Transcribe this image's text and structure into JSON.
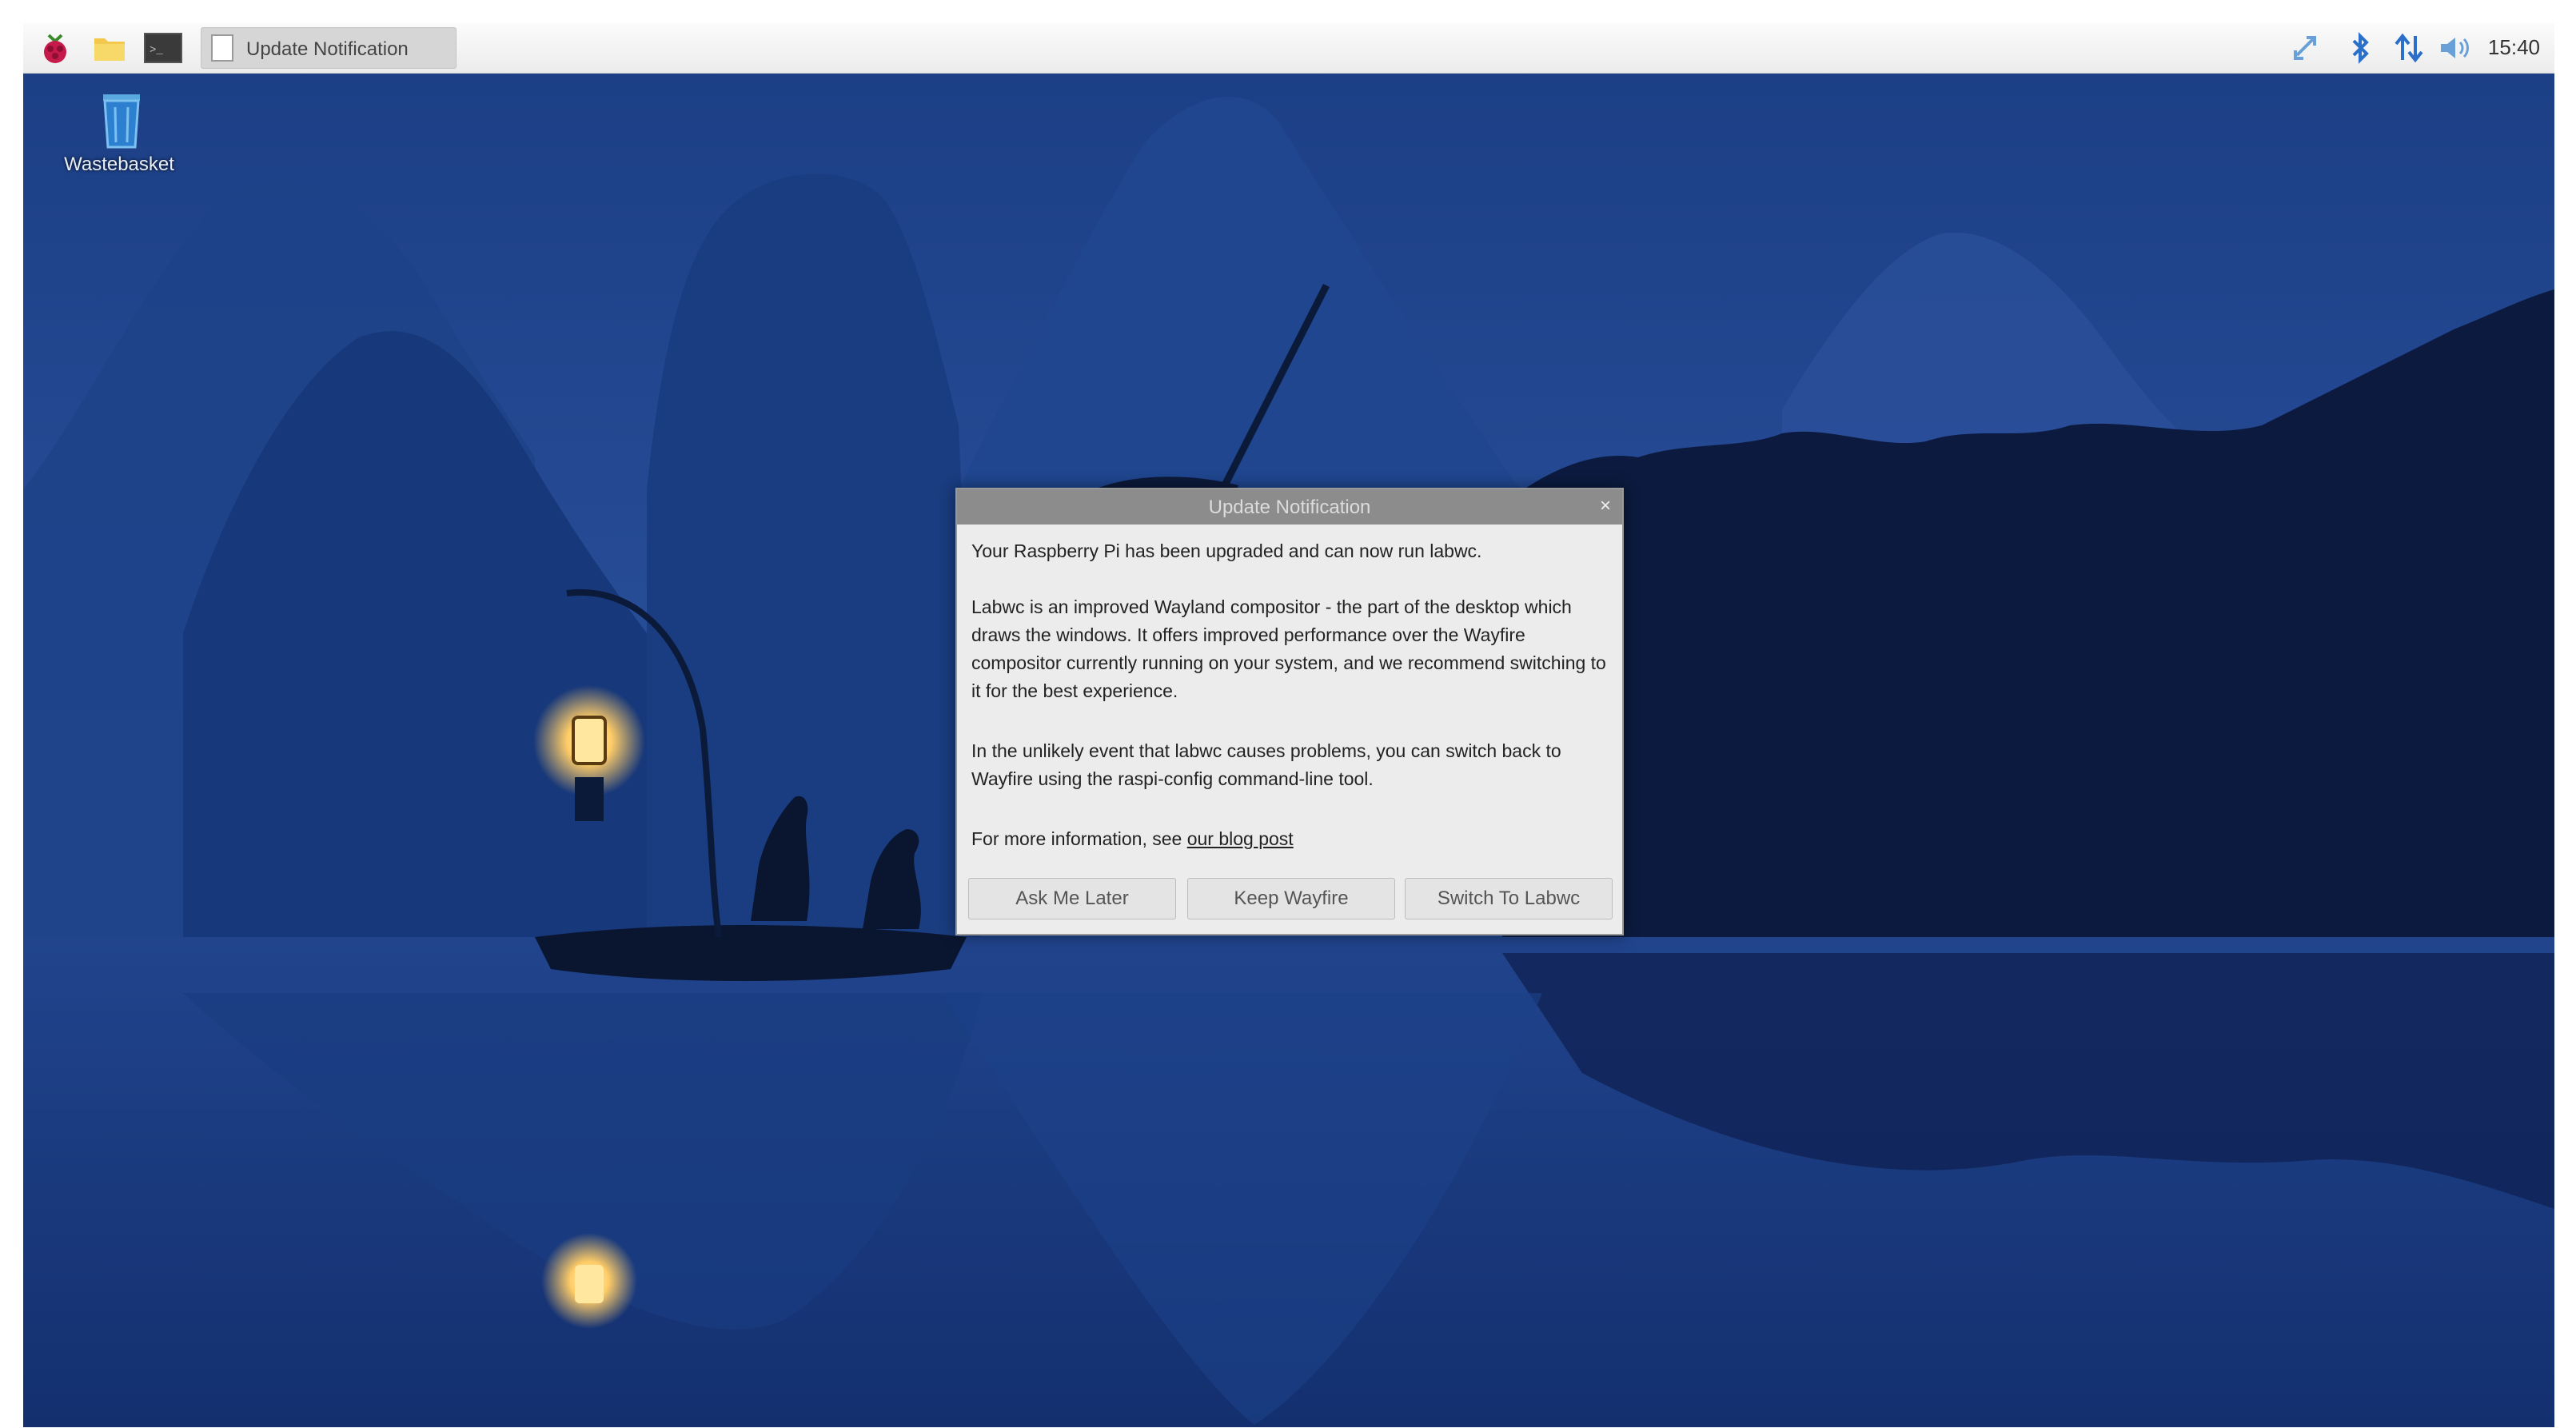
{
  "taskbar": {
    "launchers": [
      {
        "icon": "raspberry-menu-icon"
      },
      {
        "icon": "folder-icon"
      },
      {
        "icon": "terminal-icon"
      }
    ],
    "task_button": {
      "label": "Update Notification",
      "icon": "document-icon"
    },
    "tray": [
      {
        "icon": "sync-icon"
      },
      {
        "icon": "bluetooth-icon"
      },
      {
        "icon": "network-arrows-icon"
      },
      {
        "icon": "volume-icon"
      }
    ],
    "clock": "15:40"
  },
  "desktop": {
    "icons": [
      {
        "label": "Wastebasket",
        "icon": "trash-icon"
      }
    ]
  },
  "dialog": {
    "title": "Update Notification",
    "close_symbol": "×",
    "paragraphs": [
      "Your Raspberry Pi has been upgraded and can now run labwc.",
      "Labwc is an improved Wayland compositor - the part of the desktop which draws the windows. It offers improved performance over the Wayfire compositor currently running on your system, and we recommend switching to it for the best experience.",
      "In the unlikely event that labwc causes problems, you can switch back to Wayfire using the raspi-config command-line tool."
    ],
    "more_info_prefix": "For more information, see ",
    "more_info_link": "our blog post",
    "buttons": {
      "ask_later": "Ask Me Later",
      "keep_wayfire": "Keep Wayfire",
      "switch_labwc": "Switch To Labwc"
    }
  },
  "colors": {
    "sky": "#274b93",
    "mountain": "#1a3a7c",
    "water": "#1b3a80",
    "lantern": "#ffd57a"
  }
}
